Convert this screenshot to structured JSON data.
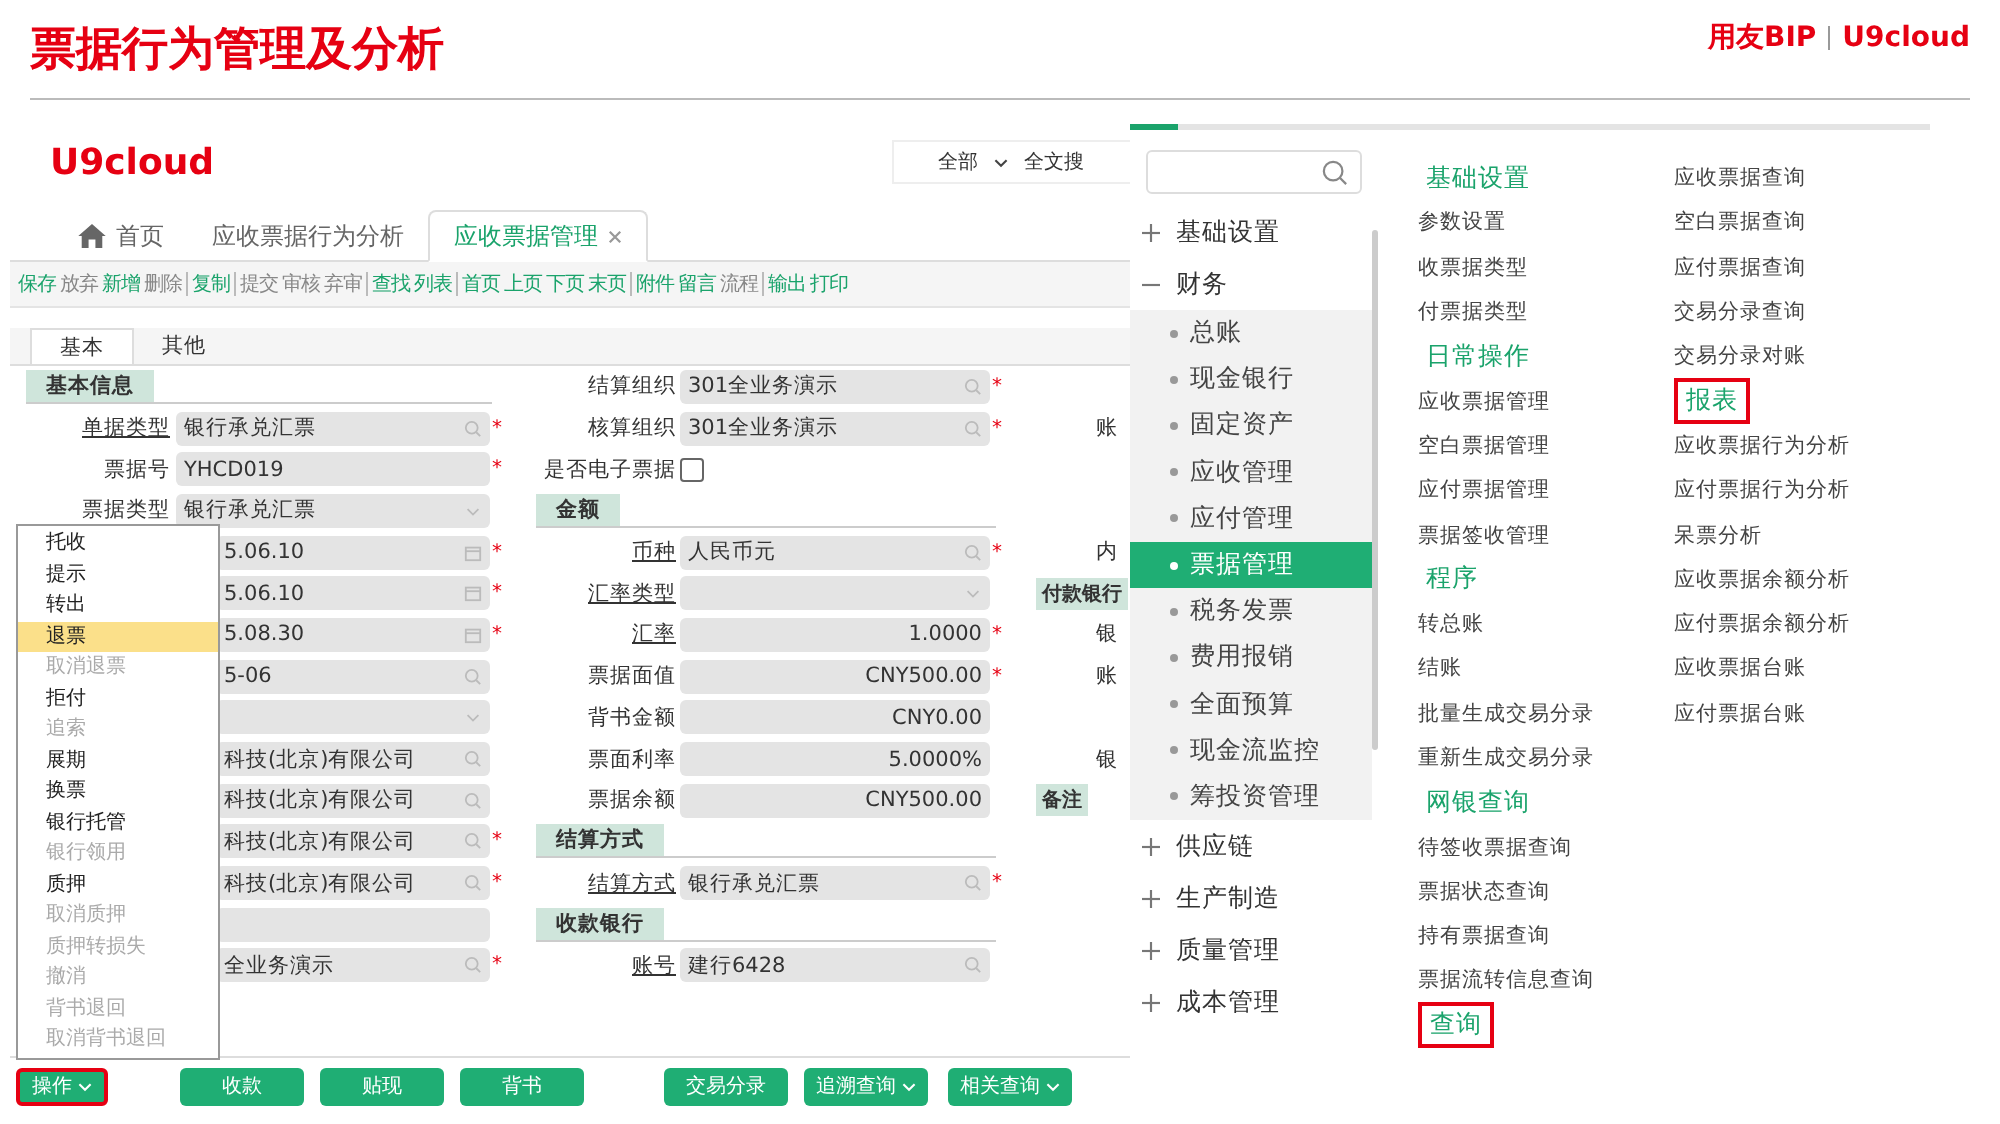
{
  "slide": {
    "title": "票据行为管理及分析",
    "brand": "用友BIP",
    "brand_product": "U9cloud"
  },
  "app": {
    "logo": "U9cloud",
    "search_scope": "全部",
    "search_hint": "全文搜",
    "tabs": [
      {
        "label": "首页",
        "kind": "home",
        "selected": false
      },
      {
        "label": "应收票据行为分析",
        "kind": "page",
        "selected": false
      },
      {
        "label": "应收票据管理",
        "kind": "page",
        "selected": true
      }
    ],
    "toolbar": [
      [
        {
          "label": "保存",
          "enabled": true
        },
        {
          "label": "放弃",
          "enabled": false
        },
        {
          "label": "新增",
          "enabled": true
        },
        {
          "label": "删除",
          "enabled": false
        }
      ],
      [
        {
          "label": "复制",
          "enabled": true
        }
      ],
      [
        {
          "label": "提交",
          "enabled": false
        },
        {
          "label": "审核",
          "enabled": false
        },
        {
          "label": "弃审",
          "enabled": false
        }
      ],
      [
        {
          "label": "查找",
          "enabled": true
        },
        {
          "label": "列表",
          "enabled": true
        }
      ],
      [
        {
          "label": "首页",
          "enabled": true
        },
        {
          "label": "上页",
          "enabled": true
        },
        {
          "label": "下页",
          "enabled": true
        },
        {
          "label": "末页",
          "enabled": true
        }
      ],
      [
        {
          "label": "附件",
          "enabled": true
        },
        {
          "label": "留言",
          "enabled": true
        },
        {
          "label": "流程",
          "enabled": false
        }
      ],
      [
        {
          "label": "输出",
          "enabled": true
        },
        {
          "label": "打印",
          "enabled": true
        }
      ]
    ],
    "form_tabs": [
      {
        "label": "基本",
        "selected": true
      },
      {
        "label": "其他",
        "selected": false
      }
    ],
    "left_column": [
      {
        "kind": "section",
        "label": "基本信息"
      },
      {
        "kind": "lookup",
        "label": "单据类型",
        "value": "银行承兑汇票",
        "required_mark": "*",
        "link": true
      },
      {
        "kind": "text",
        "label": "票据号",
        "value": "YHCD019",
        "required_mark": "*",
        "link": false
      },
      {
        "kind": "select",
        "label": "票据类型",
        "value": "银行承兑汇票",
        "link": false
      },
      {
        "kind": "date",
        "value": "5.06.10",
        "required_mark": "*"
      },
      {
        "kind": "date",
        "value": "5.06.10",
        "required_mark": "*"
      },
      {
        "kind": "date",
        "value": "5.08.30",
        "required_mark": "*"
      },
      {
        "kind": "lookup",
        "value": "5-06"
      },
      {
        "kind": "select"
      },
      {
        "kind": "lookup",
        "value": "科技(北京)有限公司"
      },
      {
        "kind": "lookup",
        "value": "科技(北京)有限公司"
      },
      {
        "kind": "lookup",
        "value": "科技(北京)有限公司",
        "required_mark": "*"
      },
      {
        "kind": "lookup",
        "value": "科技(北京)有限公司",
        "required_mark": "*"
      },
      {
        "kind": "text"
      },
      {
        "kind": "lookup",
        "value": "全业务演示",
        "required_mark": "*"
      }
    ],
    "mid_column": [
      {
        "kind": "lookup",
        "label": "结算组织",
        "value": "301全业务演示",
        "required_mark": "*",
        "link": false
      },
      {
        "kind": "lookup",
        "label": "核算组织",
        "value": "301全业务演示",
        "required_mark": "*",
        "link": false
      },
      {
        "kind": "checkbox",
        "label": "是否电子票据",
        "checked": false
      },
      {
        "kind": "section",
        "label": "金额"
      },
      {
        "kind": "lookup",
        "label": "币种",
        "value": "人民币元",
        "required_mark": "*",
        "link": true
      },
      {
        "kind": "select",
        "label": "汇率类型",
        "link": true
      },
      {
        "kind": "number",
        "label": "汇率",
        "value": "1.0000",
        "required_mark": "*",
        "link": true
      },
      {
        "kind": "number",
        "label": "票据面值",
        "value": "CNY500.00",
        "required_mark": "*",
        "link": false
      },
      {
        "kind": "number",
        "label": "背书金额",
        "value": "CNY0.00",
        "link": false
      },
      {
        "kind": "number",
        "label": "票面利率",
        "value": "5.0000%",
        "link": false
      },
      {
        "kind": "number",
        "label": "票据余额",
        "value": "CNY500.00",
        "link": false
      },
      {
        "kind": "section",
        "label": "结算方式"
      },
      {
        "kind": "lookup",
        "label": "结算方式",
        "value": "银行承兑汇票",
        "required_mark": "*",
        "link": true
      },
      {
        "kind": "section",
        "label": "收款银行"
      },
      {
        "kind": "lookup",
        "label": "账号",
        "value": "建行6428",
        "link": true
      }
    ],
    "right_column": [
      {
        "kind": "gap"
      },
      {
        "kind": "label",
        "label": "账"
      },
      {
        "kind": "gap"
      },
      {
        "kind": "gap"
      },
      {
        "kind": "label",
        "label": "内"
      },
      {
        "kind": "section",
        "label": "付款银行"
      },
      {
        "kind": "label",
        "label": "银"
      },
      {
        "kind": "label",
        "label": "账"
      },
      {
        "kind": "gap"
      },
      {
        "kind": "label",
        "label": "银"
      },
      {
        "kind": "section",
        "label": "备注"
      }
    ],
    "action_menu": [
      {
        "label": "托收",
        "enabled": true,
        "selected": false
      },
      {
        "label": "提示",
        "enabled": true,
        "selected": false
      },
      {
        "label": "转出",
        "enabled": true,
        "selected": false
      },
      {
        "label": "退票",
        "enabled": true,
        "selected": true
      },
      {
        "label": "取消退票",
        "enabled": false,
        "selected": false
      },
      {
        "label": "拒付",
        "enabled": true,
        "selected": false
      },
      {
        "label": "追索",
        "enabled": false,
        "selected": false
      },
      {
        "label": "展期",
        "enabled": true,
        "selected": false
      },
      {
        "label": "换票",
        "enabled": true,
        "selected": false
      },
      {
        "label": "银行托管",
        "enabled": true,
        "selected": false
      },
      {
        "label": "银行领用",
        "enabled": false,
        "selected": false
      },
      {
        "label": "质押",
        "enabled": true,
        "selected": false
      },
      {
        "label": "取消质押",
        "enabled": false,
        "selected": false
      },
      {
        "label": "质押转损失",
        "enabled": false,
        "selected": false
      },
      {
        "label": "撤消",
        "enabled": false,
        "selected": false
      },
      {
        "label": "背书退回",
        "enabled": false,
        "selected": false
      },
      {
        "label": "取消背书退回",
        "enabled": false,
        "selected": false
      }
    ],
    "bottom_buttons": [
      {
        "label": "操作",
        "dropdown": true,
        "highlighted": true
      },
      {
        "label": "收款",
        "dropdown": false,
        "highlighted": false
      },
      {
        "label": "贴现",
        "dropdown": false,
        "highlighted": false
      },
      {
        "label": "背书",
        "dropdown": false,
        "highlighted": false
      },
      {
        "label": "交易分录",
        "dropdown": false,
        "highlighted": false
      },
      {
        "label": "追溯查询",
        "dropdown": true,
        "highlighted": false
      },
      {
        "label": "相关查询",
        "dropdown": true,
        "highlighted": false
      }
    ]
  },
  "menu_panel": {
    "nav": [
      {
        "label": "基础设置",
        "expanded": false
      },
      {
        "label": "财务",
        "expanded": true,
        "children": [
          {
            "label": "总账",
            "selected": false
          },
          {
            "label": "现金银行",
            "selected": false
          },
          {
            "label": "固定资产",
            "selected": false
          },
          {
            "label": "应收管理",
            "selected": false
          },
          {
            "label": "应付管理",
            "selected": false
          },
          {
            "label": "票据管理",
            "selected": true
          },
          {
            "label": "税务发票",
            "selected": false
          },
          {
            "label": "费用报销",
            "selected": false
          },
          {
            "label": "全面预算",
            "selected": false
          },
          {
            "label": "现金流监控",
            "selected": false
          },
          {
            "label": "筹投资管理",
            "selected": false
          }
        ]
      },
      {
        "label": "供应链",
        "expanded": false
      },
      {
        "label": "生产制造",
        "expanded": false
      },
      {
        "label": "质量管理",
        "expanded": false
      },
      {
        "label": "成本管理",
        "expanded": false
      }
    ],
    "columns": [
      [
        {
          "kind": "header",
          "label": "基础设置",
          "highlighted": false
        },
        {
          "kind": "item",
          "label": "参数设置"
        },
        {
          "kind": "item",
          "label": "收票据类型"
        },
        {
          "kind": "item",
          "label": "付票据类型"
        },
        {
          "kind": "header",
          "label": "日常操作",
          "highlighted": false
        },
        {
          "kind": "item",
          "label": "应收票据管理"
        },
        {
          "kind": "item",
          "label": "空白票据管理"
        },
        {
          "kind": "item",
          "label": "应付票据管理"
        },
        {
          "kind": "item",
          "label": "票据签收管理"
        },
        {
          "kind": "header",
          "label": "程序",
          "highlighted": false
        },
        {
          "kind": "item",
          "label": "转总账"
        },
        {
          "kind": "item",
          "label": "结账"
        },
        {
          "kind": "item",
          "label": "批量生成交易分录"
        },
        {
          "kind": "item",
          "label": "重新生成交易分录"
        },
        {
          "kind": "header",
          "label": "网银查询",
          "highlighted": false
        },
        {
          "kind": "item",
          "label": "待签收票据查询"
        },
        {
          "kind": "item",
          "label": "票据状态查询"
        },
        {
          "kind": "item",
          "label": "持有票据查询"
        },
        {
          "kind": "item",
          "label": "票据流转信息查询"
        },
        {
          "kind": "header",
          "label": "查询",
          "highlighted": true
        }
      ],
      [
        {
          "kind": "item",
          "label": "应收票据查询"
        },
        {
          "kind": "item",
          "label": "空白票据查询"
        },
        {
          "kind": "item",
          "label": "应付票据查询"
        },
        {
          "kind": "item",
          "label": "交易分录查询"
        },
        {
          "kind": "item",
          "label": "交易分录对账"
        },
        {
          "kind": "header",
          "label": "报表",
          "highlighted": true
        },
        {
          "kind": "item",
          "label": "应收票据行为分析"
        },
        {
          "kind": "item",
          "label": "应付票据行为分析"
        },
        {
          "kind": "item",
          "label": "呆票分析"
        },
        {
          "kind": "item",
          "label": "应收票据余额分析"
        },
        {
          "kind": "item",
          "label": "应付票据余额分析"
        },
        {
          "kind": "item",
          "label": "应收票据台账"
        },
        {
          "kind": "item",
          "label": "应付票据台账"
        }
      ]
    ]
  }
}
